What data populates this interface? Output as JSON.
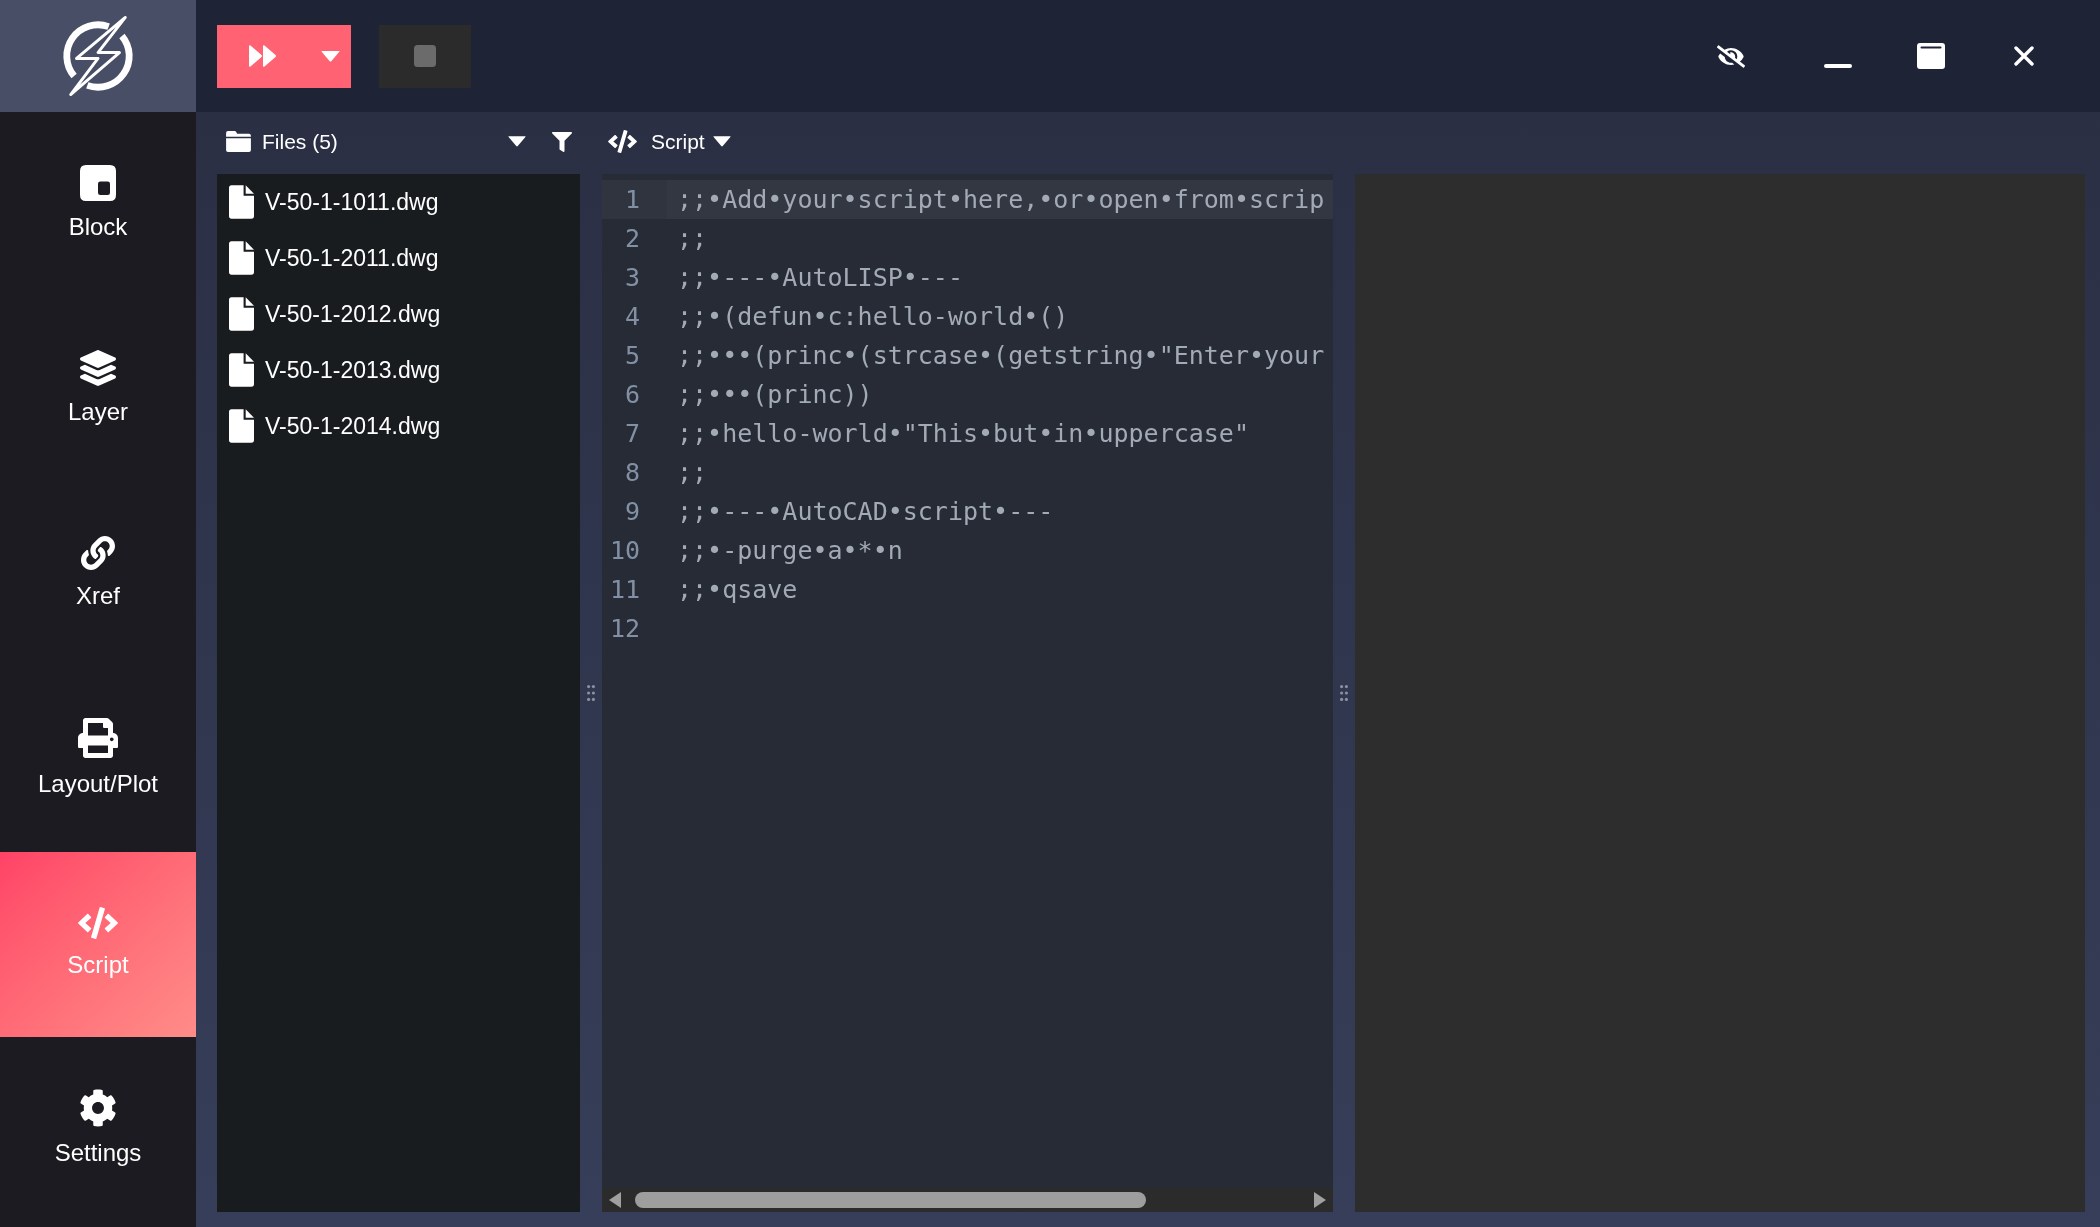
{
  "toolbar": {
    "stop_button": {
      "disabled": true
    }
  },
  "sidebar": {
    "items": [
      {
        "label": "Block",
        "selected": false
      },
      {
        "label": "Layer",
        "selected": false
      },
      {
        "label": "Xref",
        "selected": false
      },
      {
        "label": "Layout/Plot",
        "selected": false
      },
      {
        "label": "Script",
        "selected": true
      },
      {
        "label": "Settings",
        "selected": false
      }
    ]
  },
  "files_panel": {
    "title": "Files (5)",
    "files": [
      "V-50-1-1011.dwg",
      "V-50-1-2011.dwg",
      "V-50-1-2012.dwg",
      "V-50-1-2013.dwg",
      "V-50-1-2014.dwg"
    ]
  },
  "editor": {
    "title": "Script",
    "lines": [
      {
        "number": "1",
        "text": ";;•Add•your•script•here,•or•open•from•scrip",
        "active": true
      },
      {
        "number": "2",
        "text": ";;",
        "active": false
      },
      {
        "number": "3",
        "text": ";;•---•AutoLISP•---",
        "active": false
      },
      {
        "number": "4",
        "text": ";;•(defun•c:hello-world•()",
        "active": false
      },
      {
        "number": "5",
        "text": ";;•••(princ•(strcase•(getstring•\"Enter•your",
        "active": false
      },
      {
        "number": "6",
        "text": ";;•••(princ))",
        "active": false
      },
      {
        "number": "7",
        "text": ";;•hello-world•\"This•but•in•uppercase\"",
        "active": false
      },
      {
        "number": "8",
        "text": ";;",
        "active": false
      },
      {
        "number": "9",
        "text": ";;•---•AutoCAD•script•---",
        "active": false
      },
      {
        "number": "10",
        "text": ";;•-purge•a•*•n",
        "active": false
      },
      {
        "number": "11",
        "text": ";;•qsave",
        "active": false
      },
      {
        "number": "12",
        "active": false
      }
    ]
  }
}
